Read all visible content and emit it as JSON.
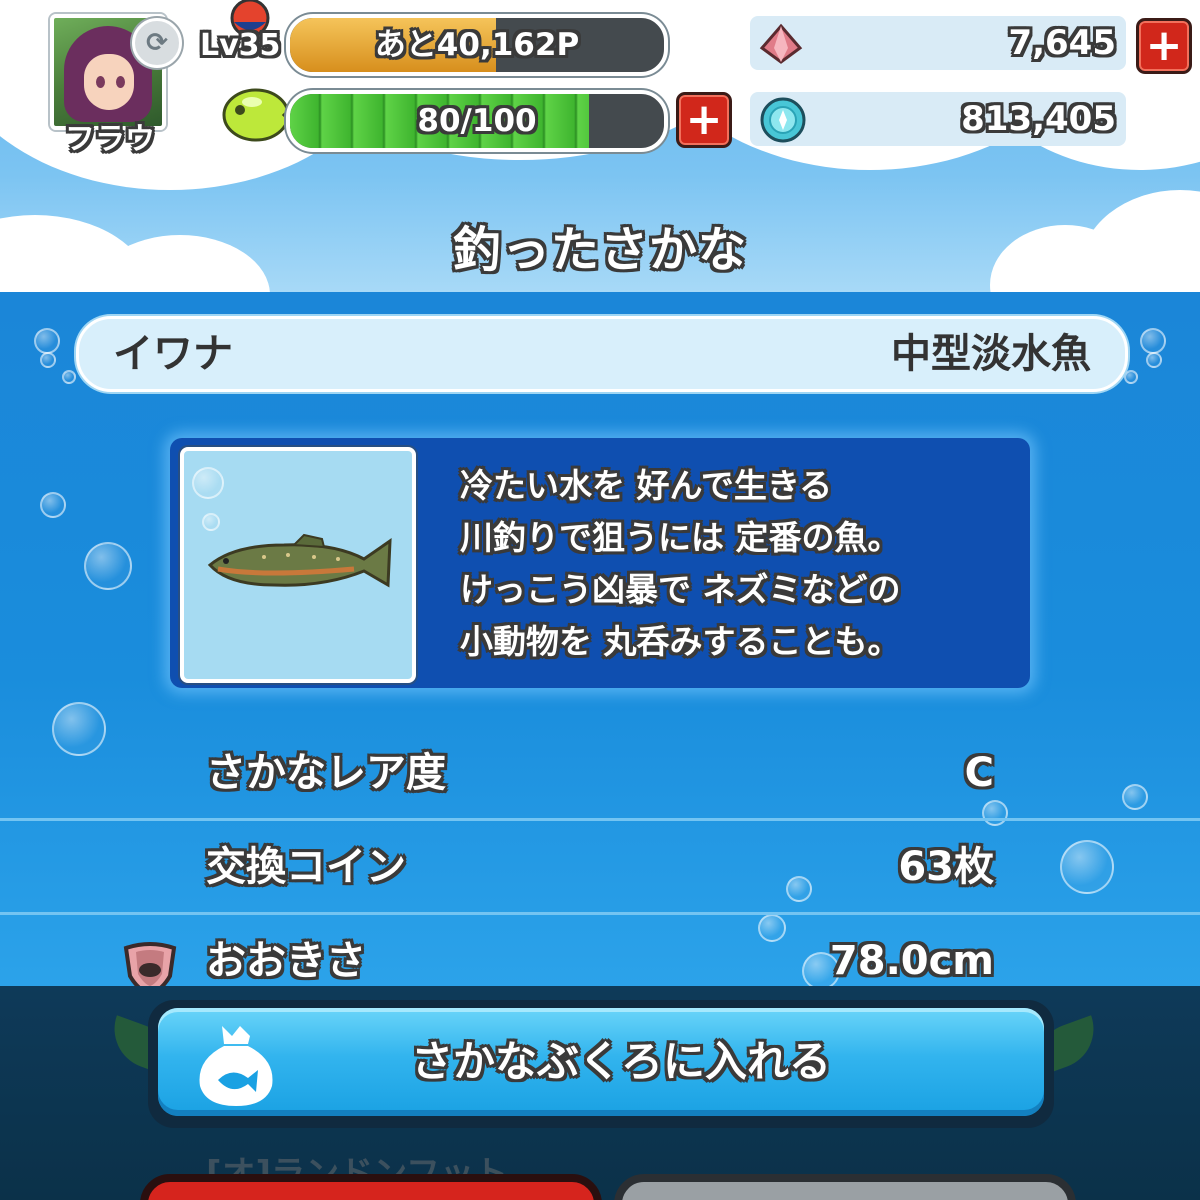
{
  "header": {
    "player_name": "フラウ",
    "level_label": "Lv35",
    "exp_remaining": "あと40,162P",
    "exp_progress": 0.55,
    "stamina": "80/100",
    "stamina_progress": 0.8,
    "gems": "7,645",
    "coins": "813,405",
    "plus_symbol": "+"
  },
  "page_title": "釣ったさかな",
  "fish": {
    "name": "イワナ",
    "type": "中型淡水魚",
    "description": [
      "冷たい水を 好んで生きる",
      "川釣りで狙うには 定番の魚。",
      "けっこう凶暴で ネズミなどの",
      "小動物を 丸呑みすることも。"
    ]
  },
  "stats": [
    {
      "label": "さかなレア度",
      "value": "C"
    },
    {
      "label": "交換コイン",
      "value": "63枚"
    },
    {
      "label": "おおきさ",
      "value": "78.0cm"
    }
  ],
  "actions": {
    "primary_label": "さかなぶくろに入れる",
    "sub_caption": "[オ]ランドンフット"
  },
  "icons": {
    "swap": "swap-icon",
    "bobber": "bobber-icon",
    "stamina_fish": "fish-stamina-icon",
    "gem": "red-gem-icon",
    "coin": "blue-coin-icon",
    "size": "size-badge-icon",
    "bag": "fish-bag-icon"
  },
  "colors": {
    "exp_fill": "#e3a12c",
    "stamina_fill": "#4cc43a",
    "plus_button": "#d1271b",
    "primary_button": "#32b4ee"
  }
}
